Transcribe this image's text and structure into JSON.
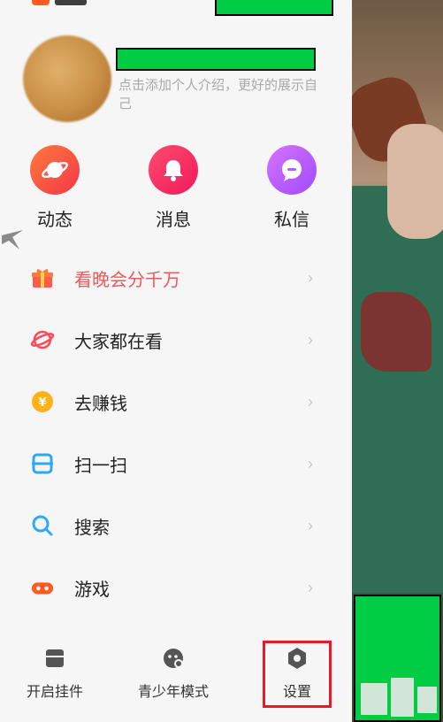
{
  "profile": {
    "bio": "点击添加个人介绍，更好的展示自己"
  },
  "quick_actions": [
    {
      "label": "动态",
      "icon": "planet-icon"
    },
    {
      "label": "消息",
      "icon": "bell-icon"
    },
    {
      "label": "私信",
      "icon": "chat-bubble-icon"
    }
  ],
  "menu": [
    {
      "label": "看晚会分千万",
      "icon": "gift-icon",
      "highlight_color": "#e95a5a"
    },
    {
      "label": "大家都在看",
      "icon": "planet-outline-icon"
    },
    {
      "label": "去赚钱",
      "icon": "yuan-coin-icon"
    },
    {
      "label": "扫一扫",
      "icon": "scan-icon"
    },
    {
      "label": "搜索",
      "icon": "search-icon"
    },
    {
      "label": "游戏",
      "icon": "gamepad-icon"
    }
  ],
  "bottom_bar": [
    {
      "label": "开启挂件",
      "icon": "widget-icon"
    },
    {
      "label": "青少年模式",
      "icon": "teen-mode-icon"
    },
    {
      "label": "设置",
      "icon": "settings-icon"
    }
  ],
  "colors": {
    "accent_red": "#e95a5a",
    "redaction_green": "#00cc44",
    "highlight_box": "#e5192a"
  }
}
